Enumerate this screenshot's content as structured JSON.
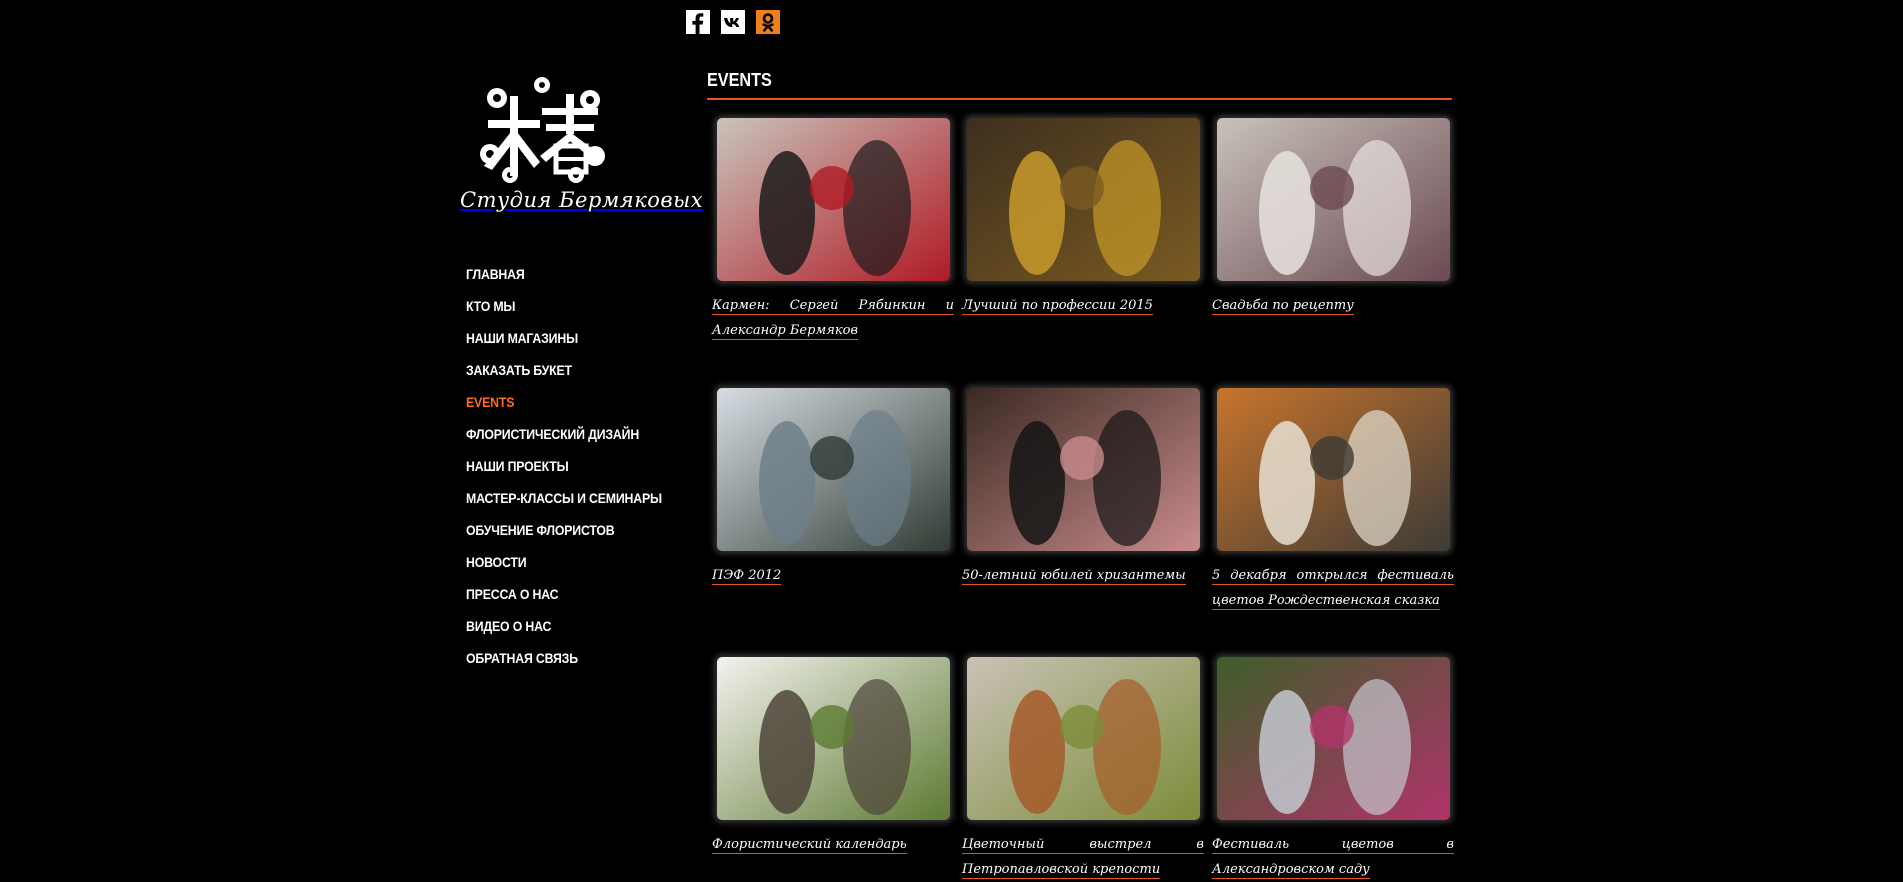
{
  "social": [
    {
      "name": "facebook-icon",
      "glyph": "f",
      "bg": "#ffffff",
      "fg": "#000000"
    },
    {
      "name": "vk-icon",
      "glyph": "vk",
      "bg": "#ffffff",
      "fg": "#000000"
    },
    {
      "name": "odnoklassniki-icon",
      "glyph": "ok",
      "bg": "#f07e1c",
      "fg": "#000000"
    }
  ],
  "logo": {
    "caption": "Студия Бермяковых"
  },
  "nav": {
    "items": [
      {
        "label": "ГЛАВНАЯ",
        "active": false
      },
      {
        "label": "КТО МЫ",
        "active": false
      },
      {
        "label": "НАШИ МАГАЗИНЫ",
        "active": false
      },
      {
        "label": "ЗАКАЗАТЬ БУКЕТ",
        "active": false
      },
      {
        "label": "EVENTS",
        "active": true
      },
      {
        "label": "ФЛОРИСТИЧЕСКИЙ ДИЗАЙН",
        "active": false
      },
      {
        "label": "НАШИ ПРОЕКТЫ",
        "active": false
      },
      {
        "label": "МАСТЕР-КЛАССЫ И СЕМИНАРЫ",
        "active": false
      },
      {
        "label": "ОБУЧЕНИЕ ФЛОРИСТОВ",
        "active": false
      },
      {
        "label": "НОВОСТИ",
        "active": false
      },
      {
        "label": "ПРЕССА О НАС",
        "active": false
      },
      {
        "label": "ВИДЕО О НАС",
        "active": false
      },
      {
        "label": "ОБРАТНАЯ СВЯЗЬ",
        "active": false
      }
    ]
  },
  "main": {
    "title": "EVENTS",
    "accent": "#e8531c",
    "events": [
      {
        "caption": "Кармен: Сергей Рябинкин и Александр Бермяков",
        "palette": [
          "#c9c4bc",
          "#1d1b1c",
          "#b01a24"
        ]
      },
      {
        "caption": "Лучший по профессии 2015",
        "palette": [
          "#3d2f1e",
          "#c79a2a",
          "#7a5a22"
        ]
      },
      {
        "caption": "Свадьба по рецепту",
        "palette": [
          "#c8c2bb",
          "#e8e3de",
          "#6b4a52"
        ]
      },
      {
        "caption": "ПЭФ 2012",
        "palette": [
          "#d7dde3",
          "#6e7f8a",
          "#2f3b33"
        ]
      },
      {
        "caption": "50-летний юбилей хризантемы",
        "palette": [
          "#3b2a22",
          "#151515",
          "#c98b8d"
        ]
      },
      {
        "caption": "5 декабря открылся фестиваль цветов Рождественская сказка",
        "palette": [
          "#c8742c",
          "#e7e0d1",
          "#3d3b36"
        ]
      },
      {
        "caption": "Флористический календарь",
        "palette": [
          "#f4f2ee",
          "#4d4439",
          "#5d7a32"
        ]
      },
      {
        "caption": "Цветочный выстрел в Петропавловской крепости",
        "palette": [
          "#c9c2b6",
          "#a65b2a",
          "#7d8c3a"
        ]
      },
      {
        "caption": "Фестиваль цветов в Александровском саду",
        "palette": [
          "#3e5e2a",
          "#c4c8cf",
          "#b0336a"
        ]
      }
    ]
  }
}
